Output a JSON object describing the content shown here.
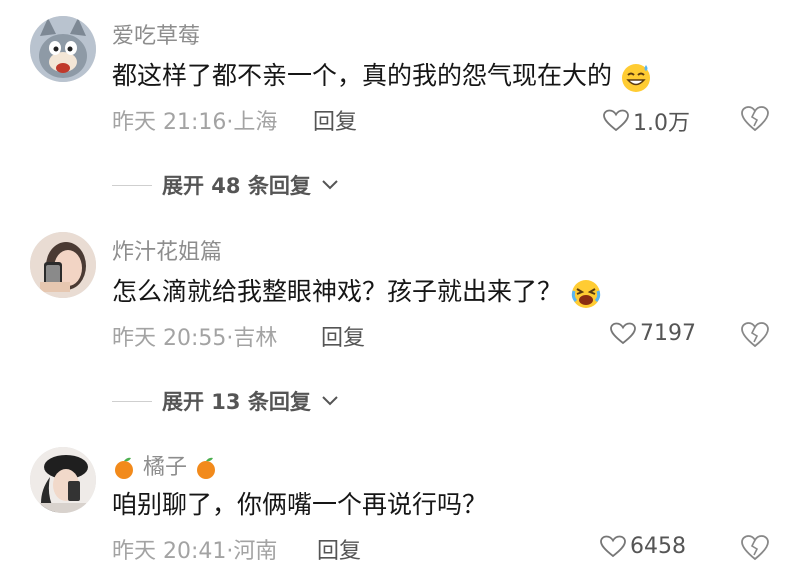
{
  "comments": [
    {
      "username": "爱吃草莓",
      "text": "都这样了都不亲一个，真的我的怨气现在大的",
      "time": "昨天 21:16·上海",
      "reply_label": "回复",
      "likes": "1.0万",
      "expand_label": "展开 48 条回复"
    },
    {
      "username": "炸汁花姐篇",
      "text": "怎么滴就给我整眼神戏？孩子就出来了？",
      "time": "昨天 20:55·吉林",
      "reply_label": "回复",
      "likes": "7197",
      "expand_label": "展开 13 条回复"
    },
    {
      "username": "橘子",
      "text": "咱别聊了，你俩嘴一个再说行吗？",
      "time": "昨天 20:41·河南",
      "reply_label": "回复",
      "likes": "6458"
    }
  ],
  "icons": {
    "like": "heart-outline-icon",
    "dislike": "broken-heart-icon",
    "expand": "chevron-down-icon",
    "emoji_1": "sweat-smile-emoji-icon",
    "emoji_2": "crying-emoji-icon",
    "username_decor": "tangerine-icon"
  }
}
